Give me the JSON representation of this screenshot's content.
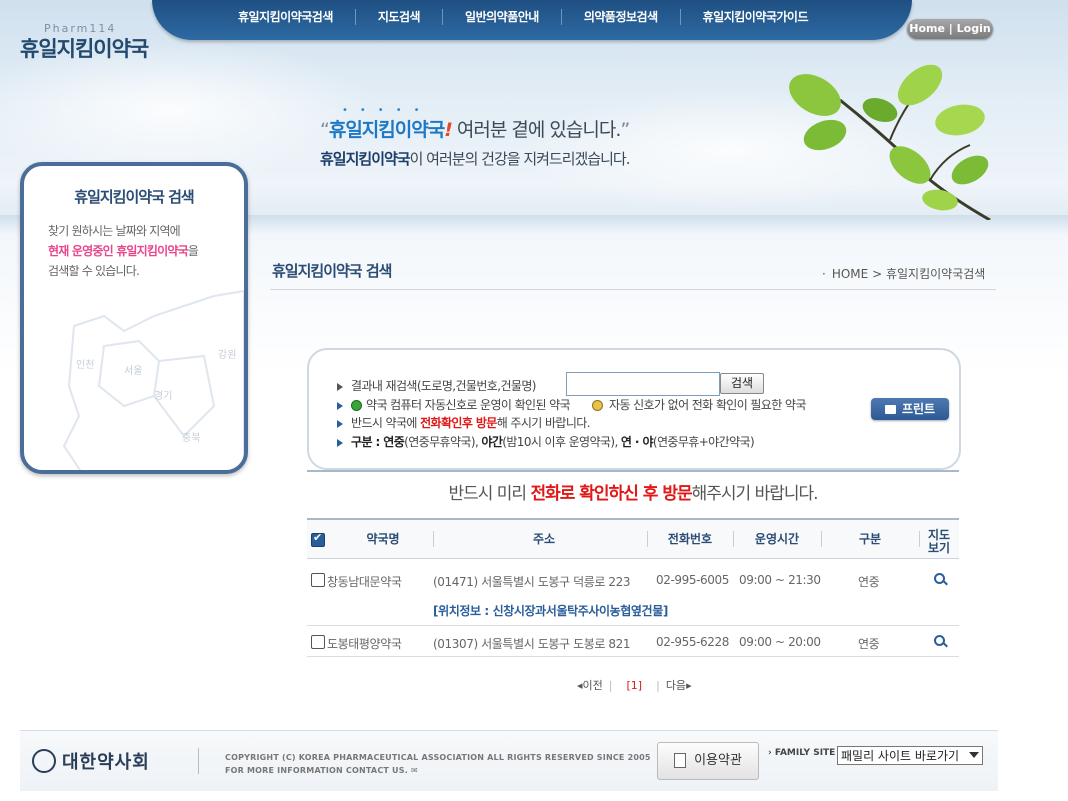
{
  "logo": {
    "sub": "Pharm114",
    "main": "휴일지킴이약국"
  },
  "nav": {
    "items": [
      {
        "label": "휴일지킴이약국검색"
      },
      {
        "label": "지도검색"
      },
      {
        "label": "일반의약품안내"
      },
      {
        "label": "의약품정보검색"
      },
      {
        "label": "휴일지킴이약국가이드"
      }
    ],
    "home_login": "Home | Login"
  },
  "hero": {
    "open_quote": "“",
    "brand": "휴일지킴이약국",
    "exclaim": "!",
    "line1_rest": " 여러분 곁에 있습니다.",
    "close_quote": "”",
    "line2_brand": "휴일지킴이약국",
    "line2_rest": "이 여러분의 건강을 지켜드리겠습니다."
  },
  "sidebar": {
    "title": "휴일지킴이약국 검색",
    "text1": "찾기 원하시는 날짜와 지역에",
    "highlight": "현재 운영중인 휴일지킴이약국",
    "text2_suffix": "을",
    "text3": "검색할 수 있습니다.",
    "map_labels": {
      "incheon": "인천",
      "seoul": "서울",
      "gyeonggi": "경기",
      "gangwon": "강원",
      "chungbuk": "충북"
    }
  },
  "page": {
    "title": "휴일지킴이약국 검색",
    "breadcrumb_home": "HOME",
    "breadcrumb_arrow": ">",
    "breadcrumb_current": "휴일지킴이약국검색"
  },
  "search": {
    "label": "결과내 재검색(도로명,건물번호,건물명)",
    "input_value": "",
    "button": "검색",
    "legend_green": "약국 컴퓨터 자동신호로 운영이 확인된 약국",
    "legend_yellow": "자동 신호가 없어 전화 확인이 필요한 약국",
    "notice1_pre": "반드시 약국에 ",
    "notice1_red": "전화확인후 방문",
    "notice1_post": "해 주시기 바랍니다.",
    "types_label": "구분 : ",
    "type1": "연중",
    "type1_desc": "(연중무휴약국), ",
    "type2": "야간",
    "type2_desc": "(밤10시 이후 운영약국), ",
    "type3": "연 · 야",
    "type3_desc": "(연중무휴+야간약국)",
    "print": "프린트"
  },
  "notice": {
    "pre": "반드시 미리 ",
    "red": "전화로 확인하신 후 방문",
    "post": "해주시기 바랍니다."
  },
  "table": {
    "headers": [
      "약국명",
      "주소",
      "전화번호",
      "운영시간",
      "구분",
      "지도보기"
    ],
    "map_header_line1": "지도",
    "map_header_line2": "보기",
    "rows": [
      {
        "name": "창동남대문약국",
        "address": "(01471) 서울특별시 도봉구 덕릉로 223",
        "phone": "02-995-6005",
        "hours": "09:00 ~ 21:30",
        "type": "연중",
        "location": "[위치정보 : 신창시장과서울탁주사이농협옆건물]"
      },
      {
        "name": "도봉태평양약국",
        "address": "(01307) 서울특별시 도봉구 도봉로 821",
        "phone": "02-955-6228",
        "hours": "09:00 ~ 20:00",
        "type": "연중",
        "location": ""
      }
    ]
  },
  "pager": {
    "prev": "이전",
    "current": "[1]",
    "next": "다음"
  },
  "footer": {
    "org": "대한약사회",
    "copyright1": "COPYRIGHT (C) KOREA PHARMACEUTICAL ASSOCIATION ALL RIGHTS RESERVED SINCE 2005",
    "copyright2": "FOR MORE INFORMATION CONTACT US.",
    "terms": "이용약관",
    "family_label": "FAMILY SITE",
    "family_select": "패밀리 사이트 바로가기"
  },
  "colors": {
    "nav_bg": "#2d6aa3",
    "title": "#2b4c74",
    "notice_red": "#e01818",
    "highlight_pink": "#e8458a",
    "sidebar_border": "#4a6d9a"
  }
}
